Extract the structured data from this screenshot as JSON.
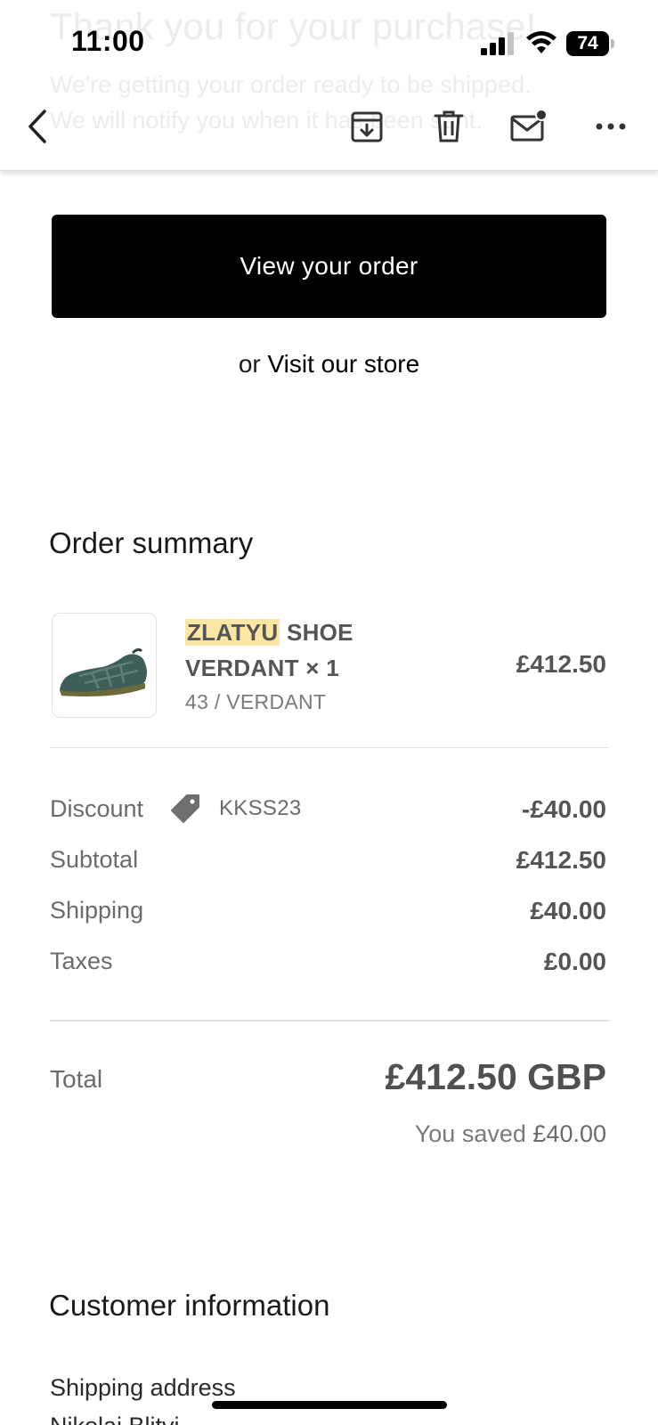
{
  "background_email": {
    "heading": "Thank you for your purchase!",
    "line1": "We're getting your order ready to be shipped.",
    "line2": "We will notify you when it has been sent."
  },
  "status_bar": {
    "time": "11:00",
    "battery": "74"
  },
  "toolbar": {
    "icons": [
      "back-icon",
      "archive-icon",
      "trash-icon",
      "mail-unread-icon",
      "more-icon"
    ]
  },
  "actions": {
    "view_order_label": "View your order",
    "or_text": "or",
    "visit_store_label": "Visit our store"
  },
  "order_summary": {
    "title": "Order summary",
    "item": {
      "brand": "ZLATYU",
      "name_rest": " SHOE",
      "name_line2": "VERDANT × 1",
      "variant": "43 / VERDANT",
      "price": "£412.50",
      "thumbnail": "shoe-image"
    },
    "discount_label": "Discount",
    "discount_code": "KKSS23",
    "discount_value": "-£40.00",
    "subtotal_label": "Subtotal",
    "subtotal_value": "£412.50",
    "shipping_label": "Shipping",
    "shipping_value": "£40.00",
    "taxes_label": "Taxes",
    "taxes_value": "£0.00",
    "total_label": "Total",
    "total_value": "£412.50 GBP",
    "saved_label": "You saved",
    "saved_value": "£40.00"
  },
  "customer_information": {
    "title": "Customer information",
    "shipping_address_label": "Shipping address",
    "name_partial": "Nikolai Blitvi..."
  },
  "colors": {
    "button_bg": "#000000",
    "brand_highlight": "#fbe6a4",
    "muted_text": "#6b6b6b"
  }
}
